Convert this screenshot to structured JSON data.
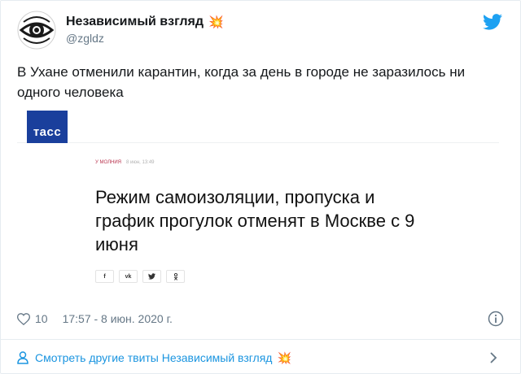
{
  "author": {
    "name": "Независимый взгляд",
    "handle": "@zgldz",
    "emoji": "💥",
    "avatar": "eye-logo"
  },
  "tweet": {
    "text": "В Ухане отменили карантин, когда за день в городе не заразилось ни одного человека"
  },
  "card": {
    "source_logo": "тасс",
    "tag": "У МОЛНИЯ",
    "date": "8 июн, 13:49",
    "headline": "Режим самоизоляции, пропуска и график прогулок отменят в Москве с 9 июня",
    "share_buttons": [
      "f",
      "vk",
      "tw",
      "ok"
    ]
  },
  "footer": {
    "likes": "10",
    "timestamp": "17:57 - 8 июн. 2020 г."
  },
  "more_tweets": {
    "label": "Смотреть другие твиты Независимый взгляд",
    "emoji": "💥"
  },
  "colors": {
    "link": "#1b95e0",
    "meta_gray": "#657786",
    "tass_blue": "#1a3f9c",
    "twitter_blue": "#1da1f2"
  },
  "icons": [
    "heart-icon",
    "info-icon",
    "person-icon",
    "chevron-right-icon",
    "twitter-bird-icon"
  ]
}
